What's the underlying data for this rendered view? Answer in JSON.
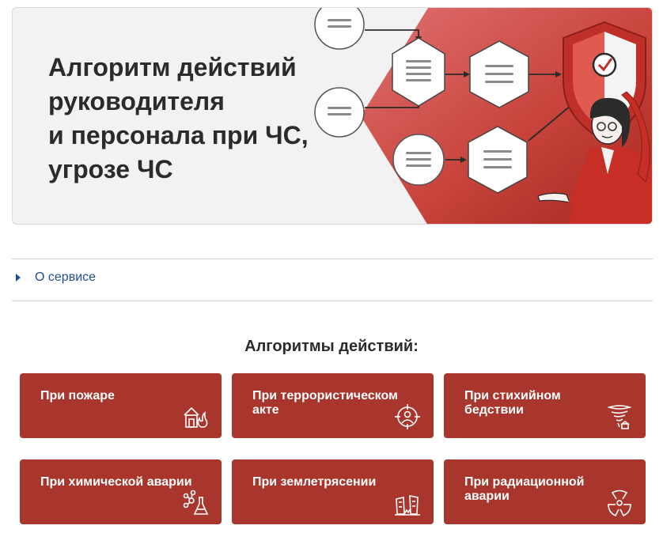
{
  "banner": {
    "title_lines": [
      "Алгоритм действий",
      "руководителя",
      "и персонала при ЧС,",
      "угрозе ЧС"
    ]
  },
  "about": {
    "label": "О сервисе"
  },
  "algorithms": {
    "title": "Алгоритмы действий:",
    "cards": [
      {
        "label": "При пожаре",
        "icon": "fire-house-icon"
      },
      {
        "label": "При террористическом акте",
        "icon": "crosshair-person-icon"
      },
      {
        "label": "При стихийном бедствии",
        "icon": "tornado-icon"
      },
      {
        "label": "При химической аварии",
        "icon": "chemical-flask-icon"
      },
      {
        "label": "При землетрясении",
        "icon": "earthquake-buildings-icon"
      },
      {
        "label": "При радиационной аварии",
        "icon": "radiation-icon"
      }
    ]
  },
  "colors": {
    "accent": "#a9362c",
    "link": "#1f4e8c",
    "banner_bg": "#f2f2f2"
  }
}
